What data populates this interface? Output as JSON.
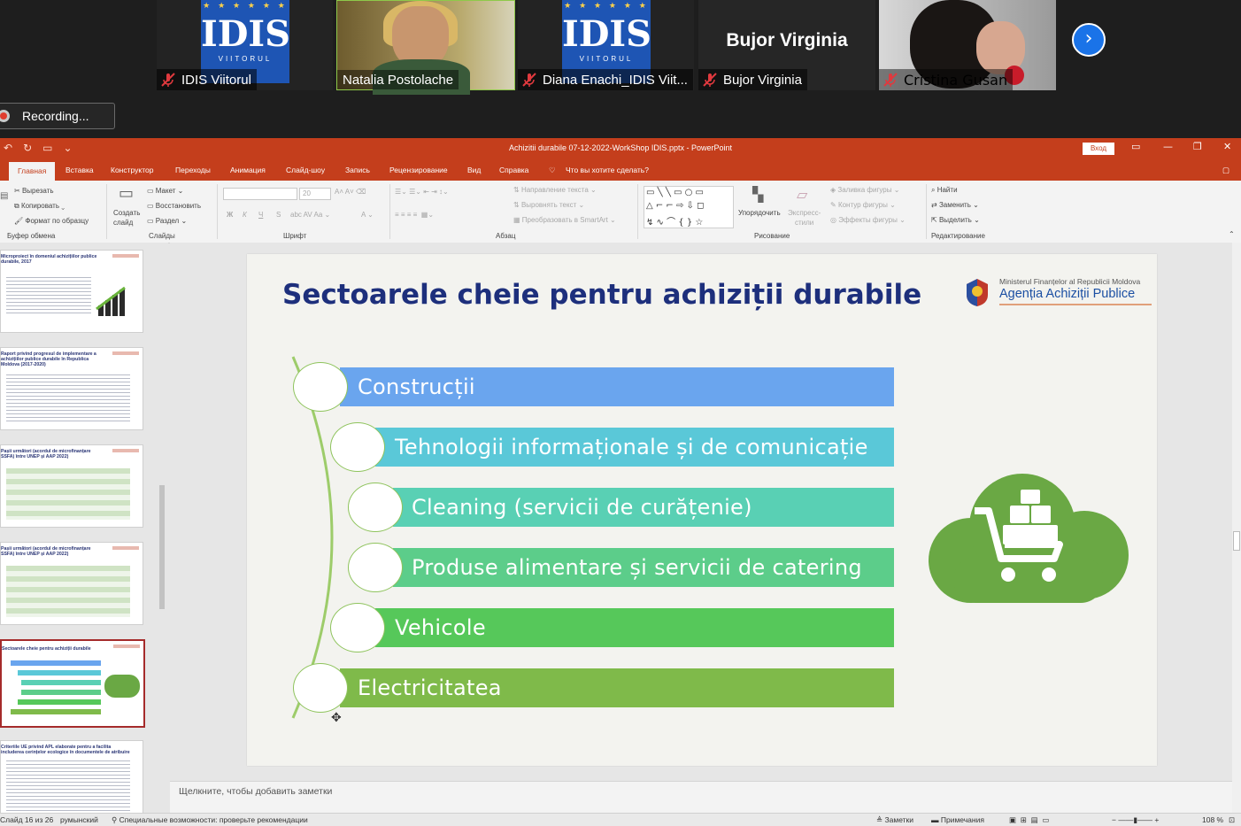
{
  "gallery": {
    "participants": [
      {
        "name": "IDIS Viitorul",
        "muted": true,
        "type": "logo"
      },
      {
        "name": "Natalia Postolache",
        "muted": false,
        "type": "camera"
      },
      {
        "name": "Diana Enachi_IDIS Viit...",
        "muted": true,
        "type": "logo"
      },
      {
        "name": "Bujor Virginia",
        "muted": true,
        "type": "name",
        "display": "Bujor Virginia"
      },
      {
        "name": "Cristina Gusan",
        "muted": true,
        "type": "camera"
      }
    ],
    "logo_text": "IDIS",
    "logo_sub": "VIITORUL",
    "recording": "Recording...",
    "next_icon": "chevron-right-icon"
  },
  "ppt": {
    "title": "Achizitii durabile 07-12-2022-WorkShop IDIS.pptx  -  PowerPoint",
    "signin": "Вход",
    "tabs": [
      "Главная",
      "Вставка",
      "Конструктор",
      "Переходы",
      "Анимация",
      "Слайд-шоу",
      "Запись",
      "Рецензирование",
      "Вид",
      "Справка",
      "Что вы хотите сделать?"
    ],
    "ribbon": {
      "clipboard": {
        "cut": "Вырезать",
        "copy": "Копировать",
        "format_painter": "Формат по образцу",
        "label": "Буфер обмена"
      },
      "slides": {
        "new_slide_1": "Создать",
        "new_slide_2": "слайд",
        "layout": "Макет",
        "reset": "Восстановить",
        "section": "Раздел",
        "label": "Слайды"
      },
      "font": {
        "size": "20",
        "label": "Шрифт"
      },
      "paragraph": {
        "text_direction": "Направление текста",
        "align_text": "Выровнять текст",
        "smartart": "Преобразовать в SmartArt",
        "label": "Абзац"
      },
      "drawing": {
        "arrange": "Упорядочить",
        "quick_styles_1": "Экспресс-",
        "quick_styles_2": "стили",
        "fill": "Заливка фигуры",
        "outline": "Контур фигуры",
        "effects": "Эффекты фигуры",
        "label": "Рисование"
      },
      "editing": {
        "find": "Найти",
        "replace": "Заменить",
        "select": "Выделить",
        "label": "Редактирование"
      }
    },
    "thumbnails": [
      {
        "title": "Microproiect în domeniul achizițiilor publice durabile, 2017"
      },
      {
        "title": "Raport privind progresul de implementare a achizițiilor publice durabile în Republica Moldova (2017-2020)"
      },
      {
        "title": "Pașii următori (acordul de microfinanțare SSFA) între UNEP și AAP 2022)"
      },
      {
        "title": "Pașii următori (acordul de microfinanțare SSFA) între UNEP și AAP 2022)"
      },
      {
        "title": "Sectoarele cheie pentru achiziții durabile"
      },
      {
        "title": "Criteriile UE privind APL elaborate pentru a facilita includerea cerințelor ecologice în documentele de atribuire"
      }
    ],
    "slide": {
      "title": "Sectoarele cheie pentru achiziții durabile",
      "agency_line1": "Ministerul Finanțelor al Republicii Moldova",
      "agency_line2": "Agenția Achiziții Publice",
      "sectors": [
        {
          "label": "Construcții",
          "color": "#6aa5ee"
        },
        {
          "label": "Tehnologii informaționale și de comunicație",
          "color": "#5ac8d8"
        },
        {
          "label": "Cleaning (servicii de curățenie)",
          "color": "#59d0b4"
        },
        {
          "label": "Produse alimentare și servicii de catering",
          "color": "#5ccd8a"
        },
        {
          "label": "Vehicole",
          "color": "#56c85a"
        },
        {
          "label": "Electricitatea",
          "color": "#7fba4a"
        }
      ],
      "icon": "cloud-shopping-cart-icon"
    },
    "notes_placeholder": "Щелкните, чтобы добавить заметки",
    "status": {
      "slide_counter": "Слайд 16 из 26",
      "language": "румынский",
      "accessibility": "Специальные возможности: проверьте рекомендации",
      "notes": "Заметки",
      "comments": "Примечания",
      "zoom": "108 %"
    }
  }
}
